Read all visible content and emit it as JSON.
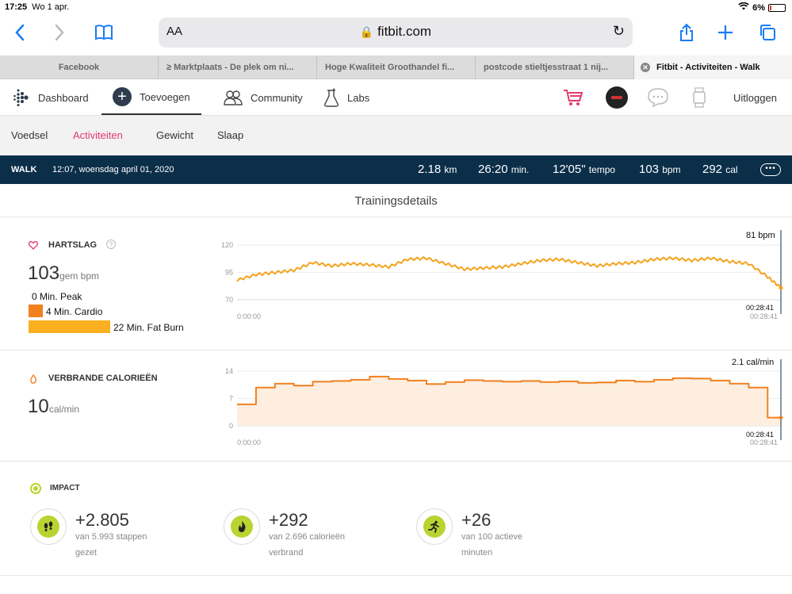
{
  "status": {
    "time": "17:25",
    "date": "Wo 1 apr.",
    "battery": "6%"
  },
  "browser": {
    "aa": "AA",
    "url": "fitbit.com"
  },
  "tabs": [
    {
      "label": "Facebook"
    },
    {
      "label": "≥ Marktplaats - De plek om ni..."
    },
    {
      "label": "Hoge Kwaliteit Groothandel fi..."
    },
    {
      "label": "postcode stieltjesstraat 1 nij..."
    },
    {
      "label": "Fitbit - Activiteiten - Walk"
    }
  ],
  "nav": {
    "dashboard": "Dashboard",
    "add": "Toevoegen",
    "community": "Community",
    "labs": "Labs",
    "logout": "Uitloggen"
  },
  "subnav": {
    "food": "Voedsel",
    "activities": "Activiteiten",
    "weight": "Gewicht",
    "sleep": "Slaap"
  },
  "walk": {
    "type": "WALK",
    "datetime": "12:07, woensdag april 01, 2020",
    "distance": "2.18",
    "distance_unit": "km",
    "duration": "26:20",
    "duration_unit": "min.",
    "pace": "12'05\"",
    "pace_unit": "tempo",
    "bpm": "103",
    "bpm_unit": "bpm",
    "cal": "292",
    "cal_unit": "cal"
  },
  "section_title": "Trainingsdetails",
  "heart": {
    "label": "HARTSLAG",
    "help": "?",
    "avg": "103",
    "avg_unit": "gem bpm",
    "zones": [
      {
        "label": "0 Min. Peak",
        "minutes": 0
      },
      {
        "label": "4 Min. Cardio",
        "minutes": 4
      },
      {
        "label": "22 Min. Fat Burn",
        "minutes": 22
      }
    ],
    "current": "81 bpm",
    "y_ticks": [
      "120",
      "95",
      "70"
    ],
    "x_start": "0:00:00",
    "x_end": "00:28:41",
    "cursor_time": "00:28:41"
  },
  "calories": {
    "label": "VERBRANDE CALORIEËN",
    "avg": "10",
    "avg_unit": "cal/min",
    "current": "2.1 cal/min",
    "y_ticks": [
      "14",
      "7",
      "0"
    ],
    "x_start": "0:00:00",
    "x_end": "00:28:41",
    "cursor_time": "00:28:41"
  },
  "impact": {
    "label": "IMPACT",
    "items": [
      {
        "icon": "footsteps-icon",
        "value": "+2.805",
        "line1": "van 5.993 stappen",
        "line2": "gezet"
      },
      {
        "icon": "flame-icon",
        "value": "+292",
        "line1": "van 2.696 calorieën",
        "line2": "verbrand"
      },
      {
        "icon": "running-icon",
        "value": "+26",
        "line1": "van 100 actieve",
        "line2": "minuten"
      }
    ]
  },
  "colors": {
    "accent": "#e33b6c",
    "navy": "#0b2e49",
    "orange": "#f1801e",
    "gold": "#fab020",
    "lime": "#b8d431"
  },
  "chart_data": [
    {
      "type": "line",
      "title": "HARTSLAG",
      "ylim": [
        70,
        120
      ],
      "x_range": [
        "0:00:00",
        "00:28:41"
      ],
      "x_minutes": [
        0,
        1,
        2,
        3,
        4,
        5,
        6,
        7,
        8,
        9,
        10,
        11,
        12,
        13,
        14,
        15,
        16,
        17,
        18,
        19,
        20,
        21,
        22,
        23,
        24,
        25,
        26,
        27,
        28,
        28.7
      ],
      "series": [
        {
          "values": [
            88,
            93,
            95,
            97,
            104,
            101,
            103,
            102,
            100,
            107,
            108,
            103,
            98,
            99,
            100,
            103,
            106,
            107,
            104,
            101,
            103,
            104,
            107,
            108,
            106,
            108,
            105,
            103,
            91,
            81
          ]
        }
      ]
    },
    {
      "type": "area",
      "title": "VERBRANDE CALORIEËN",
      "ylim": [
        0,
        14
      ],
      "x_range": [
        "0:00:00",
        "00:28:41"
      ],
      "x_minutes": [
        0,
        1,
        2,
        3,
        4,
        5,
        6,
        7,
        8,
        9,
        10,
        11,
        12,
        13,
        14,
        15,
        16,
        17,
        18,
        19,
        20,
        21,
        22,
        23,
        24,
        25,
        26,
        27,
        28,
        28.7
      ],
      "series": [
        {
          "values": [
            5.5,
            9.8,
            10.8,
            10.3,
            11.3,
            11.5,
            11.8,
            12.6,
            12.0,
            11.6,
            10.7,
            11.2,
            11.7,
            11.5,
            11.3,
            11.5,
            11.2,
            11.4,
            11.0,
            11.1,
            11.6,
            11.3,
            11.8,
            12.2,
            12.1,
            11.6,
            10.8,
            9.8,
            2.1,
            2.1
          ]
        }
      ]
    }
  ]
}
